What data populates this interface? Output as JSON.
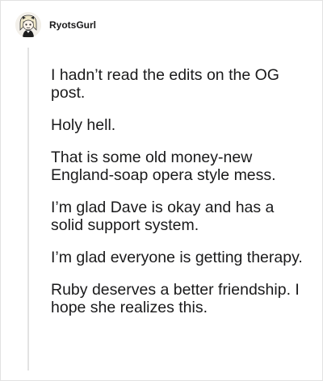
{
  "comment": {
    "username": "RyotsGurl",
    "avatar_icon": "cartoon-avatar-icon",
    "paragraphs": [
      "I hadn’t read the edits on the OG post.",
      "Holy hell.",
      "That is some old money-new England-soap opera style mess.",
      "I’m glad Dave is okay and has a solid support system.",
      "I’m glad everyone is getting therapy.",
      "Ruby deserves a better friendship. I hope she realizes this."
    ]
  }
}
